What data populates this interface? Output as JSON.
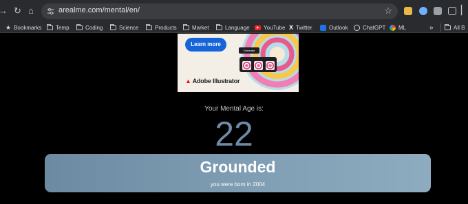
{
  "browser": {
    "url": "arealme.com/mental/en/",
    "nav_icons": [
      "back-icon",
      "reload-icon",
      "home-icon"
    ],
    "bookmarks": [
      {
        "label": "Bookmarks",
        "icon": "star-icon"
      },
      {
        "label": "Temp",
        "icon": "folder-icon"
      },
      {
        "label": "Coding",
        "icon": "folder-icon"
      },
      {
        "label": "Science",
        "icon": "folder-icon"
      },
      {
        "label": "Products",
        "icon": "folder-icon"
      },
      {
        "label": "Market",
        "icon": "folder-icon"
      },
      {
        "label": "Language",
        "icon": "folder-icon"
      },
      {
        "label": "YouTube",
        "icon": "youtube-icon"
      },
      {
        "label": "Twitter",
        "icon": "x-icon"
      },
      {
        "label": "Outlook",
        "icon": "outlook-icon"
      },
      {
        "label": "ChatGPT",
        "icon": "chatgpt-icon"
      },
      {
        "label": "ML",
        "icon": "google-drive-icon"
      },
      {
        "label": "All B",
        "icon": "folder-icon"
      }
    ],
    "overflow_label": "»"
  },
  "ad": {
    "button_label": "Learn more",
    "generate_label": "Generate",
    "brand": "Adobe Illustrator"
  },
  "result": {
    "label": "Your Mental Age is:",
    "age": "22",
    "title": "Grounded",
    "subtitle": "you were born in 2004"
  },
  "colors": {
    "age": "#6f8aa6",
    "card": "#7e9db3",
    "ad_button": "#1565d8"
  }
}
